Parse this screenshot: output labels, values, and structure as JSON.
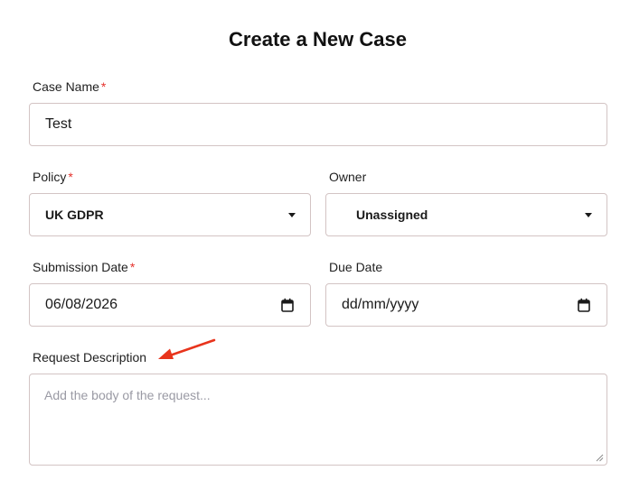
{
  "form": {
    "title": "Create a New Case",
    "case_name": {
      "label": "Case Name",
      "required_mark": "*",
      "value": "Test"
    },
    "policy": {
      "label": "Policy",
      "required_mark": "*",
      "selected": "UK GDPR"
    },
    "owner": {
      "label": "Owner",
      "selected": "Unassigned"
    },
    "submission_date": {
      "label": "Submission Date",
      "required_mark": "*",
      "value": "06/08/2026"
    },
    "due_date": {
      "label": "Due Date",
      "value": "dd/mm/yyyy"
    },
    "request_description": {
      "label": "Request Description",
      "placeholder": "Add the body of the request..."
    }
  },
  "icons": {
    "dropdown": "chevron-down-icon",
    "calendar": "calendar-icon",
    "resize": "resize-handle-icon",
    "annotation": "arrow-annotation-icon"
  },
  "colors": {
    "required": "#e5322d",
    "border": "#d3c4c4",
    "placeholder": "#9a9aa4",
    "annotation_arrow": "#e8341c"
  }
}
